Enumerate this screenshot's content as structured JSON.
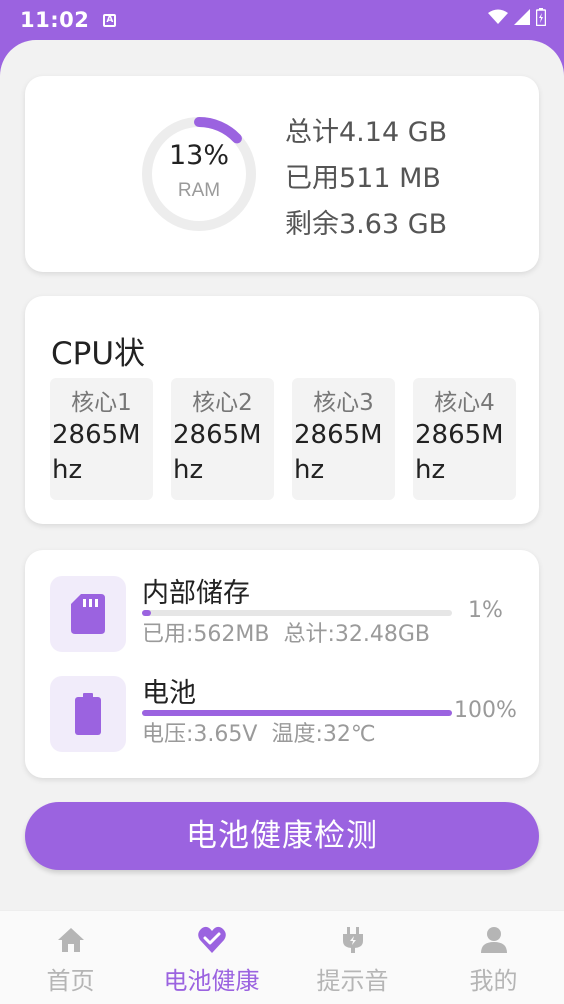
{
  "status_bar": {
    "time": "11:02",
    "notification_badge": "A"
  },
  "ram": {
    "percent_text": "13%",
    "percent_value": 0.13,
    "label": "RAM",
    "total": "总计4.14 GB",
    "used": "已用511 MB",
    "free": "剩余3.63 GB"
  },
  "cpu": {
    "title": "CPU状",
    "cores": [
      {
        "name": "核心1",
        "freq": "2865Mhz"
      },
      {
        "name": "核心2",
        "freq": "2865Mhz"
      },
      {
        "name": "核心3",
        "freq": "2865Mhz"
      },
      {
        "name": "核心4",
        "freq": "2865Mhz"
      }
    ]
  },
  "storage": {
    "title": "内部储存",
    "used": "已用:562MB",
    "total": "总计:32.48GB",
    "percent_text": "1%",
    "percent_value": 0.01,
    "icon": "sd-card-icon"
  },
  "battery": {
    "title": "电池",
    "voltage": "电压:3.65V",
    "temperature": "温度:32℃",
    "percent_text": "100%",
    "percent_value": 1.0,
    "icon": "battery-icon"
  },
  "actions": {
    "check_button": "电池健康检测"
  },
  "nav": {
    "items": [
      {
        "label": "首页",
        "icon": "home-icon",
        "active": false
      },
      {
        "label": "电池健康",
        "icon": "heart-check-icon",
        "active": true
      },
      {
        "label": "提示音",
        "icon": "plug-icon",
        "active": false
      },
      {
        "label": "我的",
        "icon": "user-icon",
        "active": false
      }
    ]
  },
  "colors": {
    "accent": "#9b63e0",
    "background": "#f2f2f2",
    "card": "#ffffff"
  }
}
